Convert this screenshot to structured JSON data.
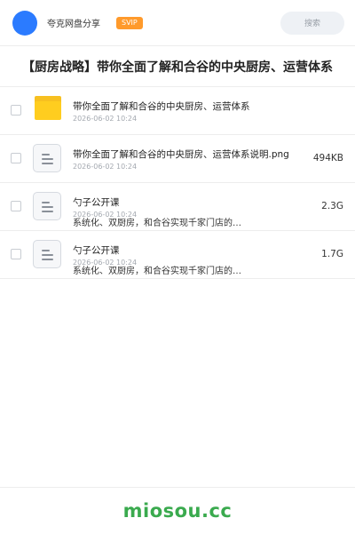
{
  "header": {
    "app_name": "夸克网盘分享",
    "vip_badge": "SVIP",
    "search_label": "搜索"
  },
  "page_title": "【厨房战略】带你全面了解和合谷的中央厨房、运营体系",
  "files": [
    {
      "name": "带你全面了解和合谷的中央厨房、运营体系",
      "date": "2026-06-02 10:24",
      "icon": "folder-icon"
    },
    {
      "name": "带你全面了解和合谷的中央厨房、运营体系说明.png",
      "date": "2026-06-02 10:24",
      "size": "494KB",
      "icon": "file-icon"
    },
    {
      "name": "勺子公开课",
      "date": "2026-06-02 10:24",
      "description": "系统化、双厨房，和合谷实现千家门店的…",
      "size": "2.3G",
      "icon": "file-icon"
    },
    {
      "name": "勺子公开课",
      "date": "2026-06-02 10:24",
      "description": "系统化、双厨房，和合谷实现千家门店的…",
      "size": "1.7G",
      "icon": "file-icon"
    }
  ],
  "footer": {
    "logo": "miosou.cc"
  },
  "colors": {
    "avatar": "#2b7bff",
    "vip_badge": "#ff9a2b",
    "folder": "#ffcd1f",
    "logo": "#3aaa4e"
  }
}
